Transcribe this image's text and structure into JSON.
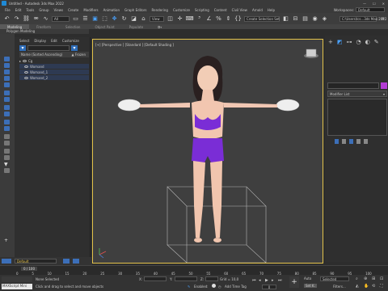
{
  "window": {
    "title": "Untitled - Autodesk 3ds Max 2022"
  },
  "menu": [
    "File",
    "Edit",
    "Tools",
    "Group",
    "Views",
    "Create",
    "Modifiers",
    "Animation",
    "Graph Editors",
    "Rendering",
    "Customize",
    "Scripting",
    "Content",
    "Civil View",
    "Arnold",
    "Help"
  ],
  "workspace": {
    "label": "Workspaces:",
    "value": "Default"
  },
  "toolbar": {
    "filter_value": "All",
    "view_value": "View",
    "named_sel": "Create Selection Set",
    "path": "C:\\Users\\Ics...3ds Max 2022"
  },
  "ribbon": {
    "tabs": [
      "Modeling",
      "Freeform",
      "Selection",
      "Object Paint",
      "Populate"
    ],
    "active": "Modeling",
    "sub": "Polygon Modeling"
  },
  "explorer": {
    "menu": [
      "Select",
      "Display",
      "Edit",
      "Customize"
    ],
    "header": "Name (Sorted Ascending)",
    "header_right": "▲ Frozen",
    "rows": [
      "Cg",
      "Womand",
      "Womand_1",
      "Womand_2"
    ]
  },
  "viewport": {
    "label": "[+] [Perspective ] [Standard ] [Default Shading ]"
  },
  "right_panel": {
    "modifier_list": "Modifier List"
  },
  "layer": {
    "value": "Default"
  },
  "timeline": {
    "frame": "0 / 100",
    "ticks": [
      "0",
      "5",
      "10",
      "15",
      "20",
      "25",
      "30",
      "35",
      "40",
      "45",
      "50",
      "55",
      "60",
      "65",
      "70",
      "75",
      "80",
      "85",
      "90",
      "95",
      "100"
    ]
  },
  "status": {
    "selected": "None Selected",
    "hint": "Click and drag to select and move objects",
    "maxscript": "MAXScript Mini",
    "x_label": "X:",
    "y_label": "Y:",
    "z_label": "Z:",
    "grid": "Grid = 10,0",
    "add_time_tag": "Add Time Tag",
    "enabled": "Enabled:",
    "auto": "Auto",
    "set_key": "Set K.",
    "selected_dd": "Selected",
    "filters": "Filters...",
    "frame_val": "0"
  },
  "colors": {
    "accent": "#2f6db8",
    "viewport_border": "#e3c24a",
    "swimsuit": "#7a2dd6"
  }
}
